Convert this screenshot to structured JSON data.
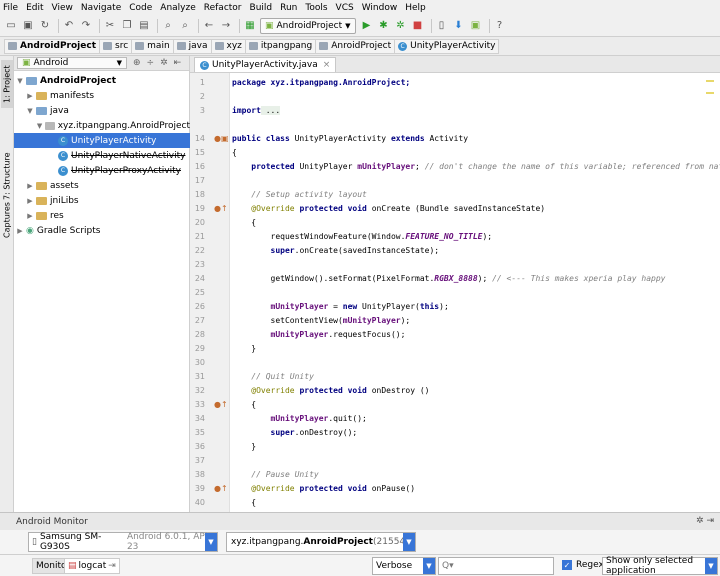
{
  "menu": [
    "File",
    "Edit",
    "View",
    "Navigate",
    "Code",
    "Analyze",
    "Refactor",
    "Build",
    "Run",
    "Tools",
    "VCS",
    "Window",
    "Help"
  ],
  "toolbar": {
    "run_config": "AndroidProject"
  },
  "breadcrumbs": [
    "AndroidProject",
    "src",
    "main",
    "java",
    "xyz",
    "itpangpang",
    "AnroidProject",
    "UnityPlayerActivity"
  ],
  "side_tabs": {
    "project": "1: Project",
    "structure": "7: Structure",
    "captures": "Captures",
    "favorites": "rites"
  },
  "project_panel": {
    "view": "Android",
    "tree": [
      {
        "label": "AndroidProject"
      },
      {
        "label": "manifests"
      },
      {
        "label": "java"
      },
      {
        "label": "xyz.itpangpang.AnroidProject"
      },
      {
        "label": "UnityPlayerActivity"
      },
      {
        "label": "UnityPlayerNativeActivity"
      },
      {
        "label": "UnityPlayerProxyActivity"
      },
      {
        "label": "assets"
      },
      {
        "label": "jniLibs"
      },
      {
        "label": "res"
      },
      {
        "label": "Gradle Scripts"
      }
    ]
  },
  "editor": {
    "tab": "UnityPlayerActivity.java",
    "line_numbers": [
      "1",
      "2",
      "3",
      "14",
      "15",
      "16",
      "17",
      "18",
      "19",
      "20",
      "21",
      "22",
      "23",
      "24",
      "25",
      "26",
      "27",
      "28",
      "29",
      "30",
      "31",
      "32",
      "33",
      "34",
      "35",
      "36",
      "37",
      "38",
      "39",
      "40",
      "41"
    ],
    "code": {
      "l1": "package xyz.itpangpang.AnroidProject;",
      "l3a": "import",
      "l3b": " ...",
      "l14a": "public class",
      "l14b": " UnityPlayerActivity ",
      "l14c": "extends",
      "l14d": " Activity",
      "l15": "{",
      "l16a": "    protected",
      "l16b": " UnityPlayer ",
      "l16c": "mUnityPlayer",
      "l16d": "; ",
      "l16e": "// don't change the name of this variable; referenced from native code",
      "l18": "    // Setup activity layout",
      "l19a": "    @Override",
      "l19b": " protected void",
      "l19c": " onCreate (Bundle savedInstanceState)",
      "l20": "    {",
      "l21a": "        requestWindowFeature(Window.",
      "l21b": "FEATURE_NO_TITLE",
      "l21c": ");",
      "l22a": "        super",
      "l22b": ".onCreate(savedInstanceState);",
      "l24a": "        getWindow().setFormat(PixelFormat.",
      "l24b": "RGBX_8888",
      "l24c": "); ",
      "l24d": "// <--- This makes xperia play happy",
      "l26a": "        mUnityPlayer",
      "l26b": " = ",
      "l26c": "new",
      "l26d": " UnityPlayer(",
      "l26e": "this",
      "l26f": ");",
      "l27a": "        setContentView(",
      "l27b": "mUnityPlayer",
      "l27c": ");",
      "l28a": "        mUnityPlayer",
      "l28b": ".requestFocus();",
      "l29": "    }",
      "l31": "    // Quit Unity",
      "l32a": "    @Override",
      "l32b": " protected void",
      "l32c": " onDestroy ()",
      "l33": "    {",
      "l34a": "        mUnityPlayer",
      "l34b": ".quit();",
      "l35a": "        super",
      "l35b": ".onDestroy();",
      "l36": "    }",
      "l38": "    // Pause Unity",
      "l39a": "    @Override",
      "l39b": " protected void",
      "l39c": " onPause()",
      "l40": "    {"
    }
  },
  "monitor": {
    "title": "Android Monitor",
    "device_name": "Samsung SM-G930S",
    "device_detail": " Android 6.0.1, API 23",
    "process_prefix": "xyz.itpangpang.",
    "process_name": "AnroidProject",
    "process_pid": " (21554)",
    "tab_monitors": "Monitors",
    "tab_logcat": "logcat",
    "log_level": "Verbose",
    "search_placeholder": "Q▾",
    "regex_label": "Regex",
    "filter": "Show only selected application"
  }
}
